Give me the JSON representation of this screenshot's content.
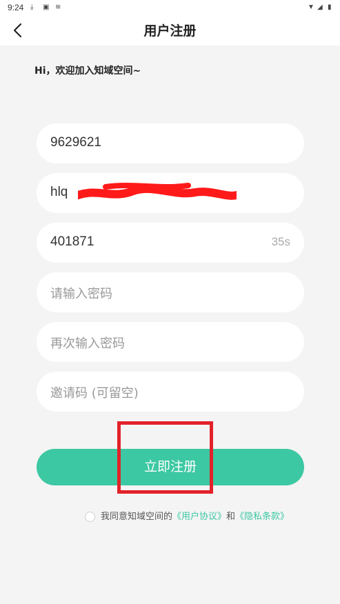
{
  "status_bar": {
    "time": "9:24",
    "left_icons": [
      "download-icon",
      "a-badge-icon",
      "notification-icon"
    ],
    "right_icons": [
      "wifi-icon",
      "signal-icon",
      "battery-icon"
    ]
  },
  "header": {
    "title": "用户注册",
    "back_icon": "chevron-left-icon"
  },
  "greeting": "Hi，欢迎加入知域空间~",
  "form": {
    "phone_value": "9629621",
    "account_value": "hlq",
    "code_value": "401871",
    "code_countdown": "35s",
    "password_placeholder": "请输入密码",
    "password_confirm_placeholder": "再次输入密码",
    "invite_placeholder": "邀请码 (可留空)"
  },
  "submit_label": "立即注册",
  "agreement": {
    "prefix": "我同意知域空间的",
    "user_agreement": "《用户协议》",
    "and": "和",
    "privacy": "《隐私条款》"
  },
  "colors": {
    "accent": "#3cc8a2",
    "background": "#f4f4f4",
    "highlight_box": "#e2222a",
    "redaction": "#ff1a1a"
  }
}
